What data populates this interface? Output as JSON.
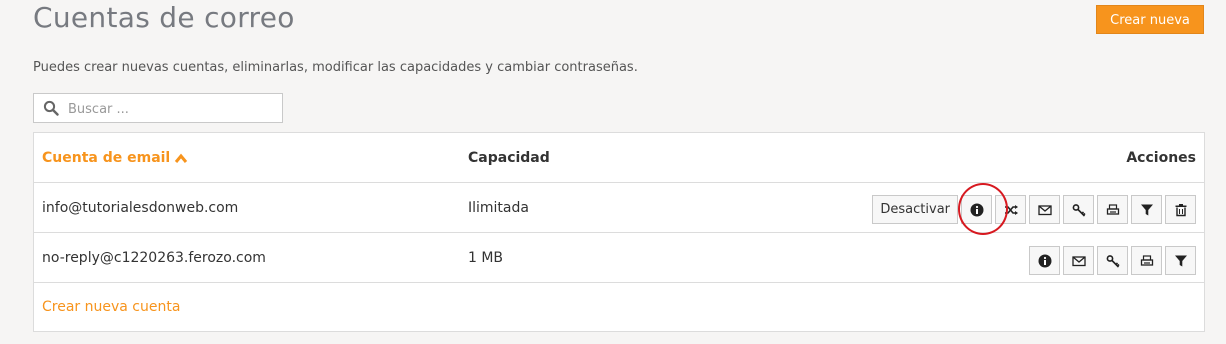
{
  "page": {
    "title": "Cuentas de correo",
    "create_button": "Crear nueva",
    "subtitle": "Puedes crear nuevas cuentas, eliminarlas, modificar las capacidades y cambiar contraseñas."
  },
  "search": {
    "placeholder": "Buscar ...",
    "value": "",
    "icon": "search-icon"
  },
  "table": {
    "headers": {
      "email": "Cuenta de email",
      "capacity": "Capacidad",
      "actions": "Acciones"
    },
    "sort": {
      "column": "email",
      "direction": "asc",
      "icon": "chevron-up-icon"
    },
    "rows": [
      {
        "email": "info@tutorialesdonweb.com",
        "capacity": "Ilimitada",
        "deactivate_label": "Desactivar",
        "actions": [
          "info-icon",
          "shuffle-icon",
          "envelope-icon",
          "key-icon",
          "printer-icon",
          "filter-icon",
          "trash-icon"
        ]
      },
      {
        "email": "no-reply@c1220263.ferozo.com",
        "capacity": "1 MB",
        "actions": [
          "info-icon",
          "envelope-icon",
          "key-icon",
          "printer-icon",
          "filter-icon"
        ]
      }
    ],
    "footer_link": "Crear nueva cuenta"
  },
  "colors": {
    "accent": "#f7941d",
    "highlight": "#d71920",
    "background": "#f6f5f4"
  }
}
